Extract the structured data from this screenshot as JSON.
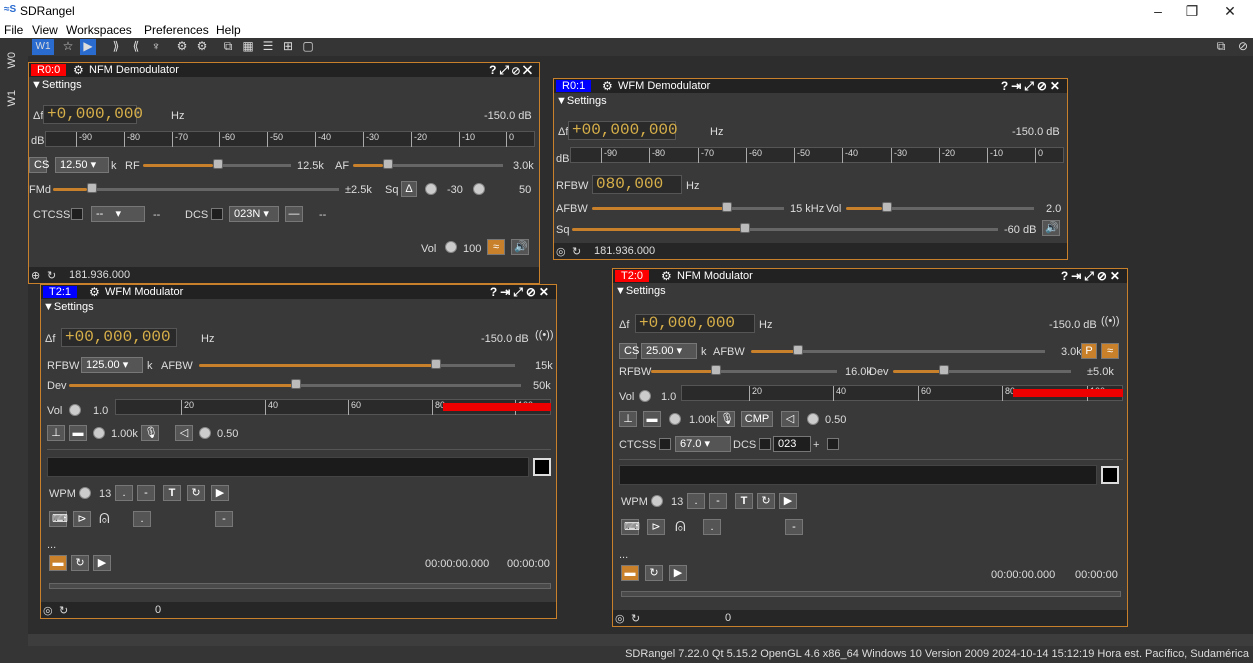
{
  "app": {
    "title": "SDRangel",
    "icon": "sdrangel-logo-icon"
  },
  "menu": [
    "File",
    "View",
    "Workspaces",
    "Preferences",
    "Help"
  ],
  "toolbar": {
    "workspace": "W1"
  },
  "sidetabs": [
    "W0",
    "W1"
  ],
  "status": "SDRangel 7.22.0 Qt 5.15.2 OpenGL 4.6 x86_64 Windows 10 Version 2009  2024-10-14 15:12:19 Hora est. Pacífico, Sudamérica",
  "colors": {
    "accent": "#c8802a",
    "rx_tag": "#ff0000",
    "rx2_tag": "#0000ff",
    "tx_tag": "#0000ff",
    "tx2_tag": "#ff0000"
  },
  "nfm": {
    "tag": "R0:0",
    "title": "NFM Demodulator",
    "settings": "Settings",
    "delta": "Δf",
    "freq": "+0,000,000",
    "hz": "Hz",
    "power": "-150.0 dB",
    "db": "dB",
    "ticks": [
      "-90",
      "-80",
      "-70",
      "-60",
      "-50",
      "-40",
      "-30",
      "-20",
      "-10",
      "0"
    ],
    "cs": "CS",
    "cs_val": "12.50",
    "k": "k",
    "rf": "RF",
    "rf_val": "12.5k",
    "af": "AF",
    "af_val": "3.0k",
    "fmd": "FMd",
    "fmd_val": "±2.5k",
    "sq": "Sq",
    "delta_btn": "Δ",
    "sq_val": "-30",
    "sq_delay": "50",
    "ctcss": "CTCSS",
    "ctcss_val": "--",
    "ctcss_dash": "--",
    "dcs": "DCS",
    "dcs_val": "023N",
    "dcs_dash": "--",
    "vol": "Vol",
    "vol_val": "100",
    "footer_freq": "181.936.000"
  },
  "wfm": {
    "tag": "R0:1",
    "title": "WFM Demodulator",
    "settings": "Settings",
    "delta": "Δf",
    "freq": "+00,000,000",
    "hz": "Hz",
    "power": "-150.0 dB",
    "db": "dB",
    "ticks": [
      "-90",
      "-80",
      "-70",
      "-60",
      "-50",
      "-40",
      "-30",
      "-20",
      "-10",
      "0"
    ],
    "rfbw": "RFBW",
    "rfbw_val": "080,000",
    "rfbw_hz": "Hz",
    "afbw": "AFBW",
    "afbw_val": "15 kHz",
    "vol": "Vol",
    "vol_val": "2.0",
    "sq": "Sq",
    "sq_val": "-60 dB",
    "footer_freq": "181.936.000"
  },
  "wfmmod": {
    "tag": "T2:1",
    "title": "WFM Modulator",
    "settings": "Settings",
    "delta": "Δf",
    "freq": "+00,000,000",
    "hz": "Hz",
    "power": "-150.0 dB",
    "rfbw": "RFBW",
    "rfbw_val": "125.00",
    "k": "k",
    "afbw": "AFBW",
    "afbw_val": "15k",
    "dev": "Dev",
    "dev_val": "50k",
    "vol": "Vol",
    "vol_num": "1.0",
    "ticks": [
      "20",
      "40",
      "60",
      "80",
      "100"
    ],
    "tone": "1.00k",
    "gain": "0.50",
    "wpm": "WPM",
    "wpm_val": "13",
    "dot": ".",
    "dash": "-",
    "t": "T",
    "mouse_dot": ".",
    "mouse_dash": "-",
    "dots": "...",
    "time1": "00:00:00.000",
    "time2": "00:00:00",
    "footer_val": "0"
  },
  "nfmmod": {
    "tag": "T2:0",
    "title": "NFM Modulator",
    "settings": "Settings",
    "delta": "Δf",
    "freq": "+0,000,000",
    "hz": "Hz",
    "power": "-150.0 dB",
    "cs": "CS",
    "cs_val": "25.00",
    "k": "k",
    "afbw": "AFBW",
    "afbw_val": "3.0k",
    "p": "P",
    "rfbw": "RFBW",
    "rfbw_val": "16.0k",
    "devl": "Dev",
    "dev_val": "±5.0k",
    "vol": "Vol",
    "vol_num": "1.0",
    "ticks": [
      "20",
      "40",
      "60",
      "80",
      "100"
    ],
    "tone": "1.00k",
    "cmp": "CMP",
    "gain": "0.50",
    "ctcss": "CTCSS",
    "ctcss_val": "67.0",
    "dcs": "DCS",
    "dcs_val": "023",
    "plus": "+",
    "wpm": "WPM",
    "wpm_val": "13",
    "dot": ".",
    "dash": "-",
    "t": "T",
    "mouse_dot": ".",
    "mouse_dash": "-",
    "dots": "...",
    "time1": "00:00:00.000",
    "time2": "00:00:00",
    "footer_val": "0"
  }
}
